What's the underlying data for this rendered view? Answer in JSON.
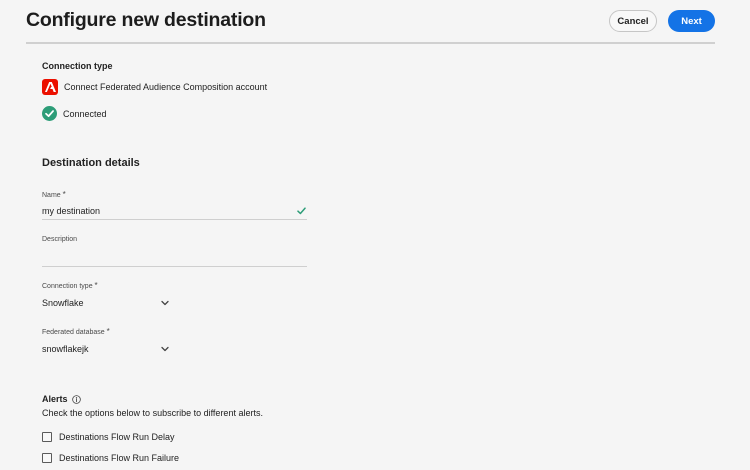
{
  "header": {
    "title": "Configure new destination",
    "cancel_label": "Cancel",
    "next_label": "Next"
  },
  "connection": {
    "section_label": "Connection type",
    "account_label": "Connect Federated Audience Composition account",
    "status_label": "Connected",
    "status_color": "#2d9d78",
    "brand_color": "#eb1000"
  },
  "details": {
    "heading": "Destination details",
    "name": {
      "label": "Name",
      "value": "my destination"
    },
    "description": {
      "label": "Description",
      "value": ""
    },
    "connection_type": {
      "label": "Connection type",
      "value": "Snowflake"
    },
    "federated_database": {
      "label": "Federated database",
      "value": "snowflakejk"
    },
    "required_marker": "*"
  },
  "alerts": {
    "heading": "Alerts",
    "description": "Check the options below to subscribe to different alerts.",
    "options": [
      {
        "label": "Destinations Flow Run Delay",
        "checked": false
      },
      {
        "label": "Destinations Flow Run Failure",
        "checked": false
      }
    ]
  }
}
